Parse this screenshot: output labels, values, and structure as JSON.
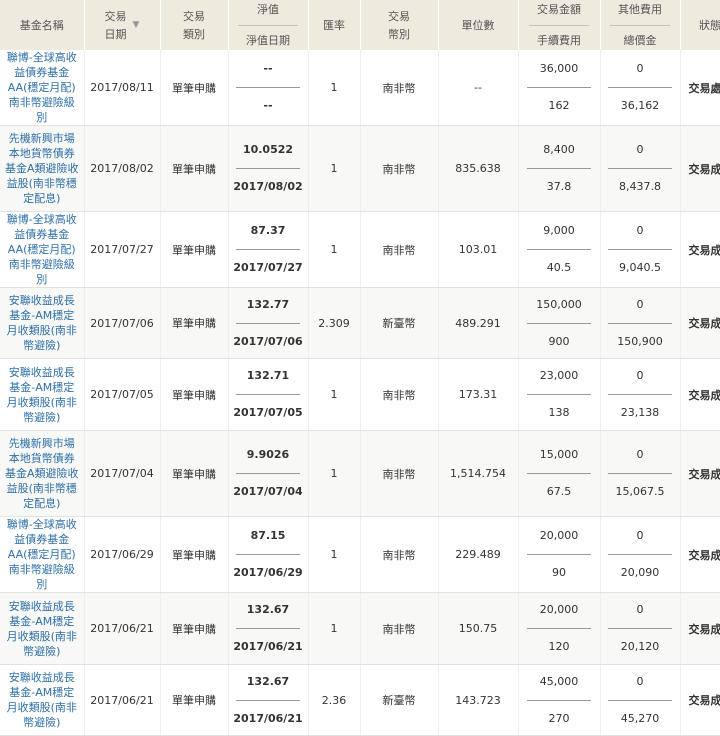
{
  "headers": {
    "fund_name": "基金名稱",
    "trade_date_a": "交易",
    "trade_date_b": "日期",
    "trade_type_a": "交易",
    "trade_type_b": "類別",
    "nav_a": "淨值",
    "nav_b": "淨值日期",
    "fx": "匯率",
    "currency_a": "交易",
    "currency_b": "幣別",
    "units": "單位數",
    "amount_a": "交易金額",
    "amount_b": "手續費用",
    "other_a": "其他費用",
    "other_b": "總價金",
    "status": "狀態"
  },
  "rows": [
    {
      "fund": "聯博-全球高收益債券基金AA(穩定月配)南非幣避險級別",
      "date": "2017/08/11",
      "type": "單筆申購",
      "nav": "--",
      "nav_date": "--",
      "fx": "1",
      "currency": "南非幣",
      "units": "--",
      "amount": "36,000",
      "fee": "162",
      "other": "0",
      "total": "36,162",
      "status": "交易處理中"
    },
    {
      "fund": "先機新興市場本地貨幣債券基金A類避險收益股(南非幣穩定配息)",
      "date": "2017/08/02",
      "type": "單筆申購",
      "nav": "10.0522",
      "nav_date": "2017/08/02",
      "fx": "1",
      "currency": "南非幣",
      "units": "835.638",
      "amount": "8,400",
      "fee": "37.8",
      "other": "0",
      "total": "8,437.8",
      "status": "交易成功"
    },
    {
      "fund": "聯博-全球高收益債券基金AA(穩定月配)南非幣避險級別",
      "date": "2017/07/27",
      "type": "單筆申購",
      "nav": "87.37",
      "nav_date": "2017/07/27",
      "fx": "1",
      "currency": "南非幣",
      "units": "103.01",
      "amount": "9,000",
      "fee": "40.5",
      "other": "0",
      "total": "9,040.5",
      "status": "交易成功"
    },
    {
      "fund": "安聯收益成長基金-AM穩定月收類股(南非幣避險)",
      "date": "2017/07/06",
      "type": "單筆申購",
      "nav": "132.77",
      "nav_date": "2017/07/06",
      "fx": "2.309",
      "currency": "新臺幣",
      "units": "489.291",
      "amount": "150,000",
      "fee": "900",
      "other": "0",
      "total": "150,900",
      "status": "交易成功"
    },
    {
      "fund": "安聯收益成長基金-AM穩定月收類股(南非幣避險)",
      "date": "2017/07/05",
      "type": "單筆申購",
      "nav": "132.71",
      "nav_date": "2017/07/05",
      "fx": "1",
      "currency": "南非幣",
      "units": "173.31",
      "amount": "23,000",
      "fee": "138",
      "other": "0",
      "total": "23,138",
      "status": "交易成功"
    },
    {
      "fund": "先機新興市場本地貨幣債券基金A類避險收益股(南非幣穩定配息)",
      "date": "2017/07/04",
      "type": "單筆申購",
      "nav": "9.9026",
      "nav_date": "2017/07/04",
      "fx": "1",
      "currency": "南非幣",
      "units": "1,514.754",
      "amount": "15,000",
      "fee": "67.5",
      "other": "0",
      "total": "15,067.5",
      "status": "交易成功"
    },
    {
      "fund": "聯博-全球高收益債券基金AA(穩定月配)南非幣避險級別",
      "date": "2017/06/29",
      "type": "單筆申購",
      "nav": "87.15",
      "nav_date": "2017/06/29",
      "fx": "1",
      "currency": "南非幣",
      "units": "229.489",
      "amount": "20,000",
      "fee": "90",
      "other": "0",
      "total": "20,090",
      "status": "交易成功"
    },
    {
      "fund": "安聯收益成長基金-AM穩定月收類股(南非幣避險)",
      "date": "2017/06/21",
      "type": "單筆申購",
      "nav": "132.67",
      "nav_date": "2017/06/21",
      "fx": "1",
      "currency": "南非幣",
      "units": "150.75",
      "amount": "20,000",
      "fee": "120",
      "other": "0",
      "total": "20,120",
      "status": "交易成功"
    },
    {
      "fund": "安聯收益成長基金-AM穩定月收類股(南非幣避險)",
      "date": "2017/06/21",
      "type": "單筆申購",
      "nav": "132.67",
      "nav_date": "2017/06/21",
      "fx": "2.36",
      "currency": "新臺幣",
      "units": "143.723",
      "amount": "45,000",
      "fee": "270",
      "other": "0",
      "total": "45,270",
      "status": "交易成功"
    }
  ]
}
